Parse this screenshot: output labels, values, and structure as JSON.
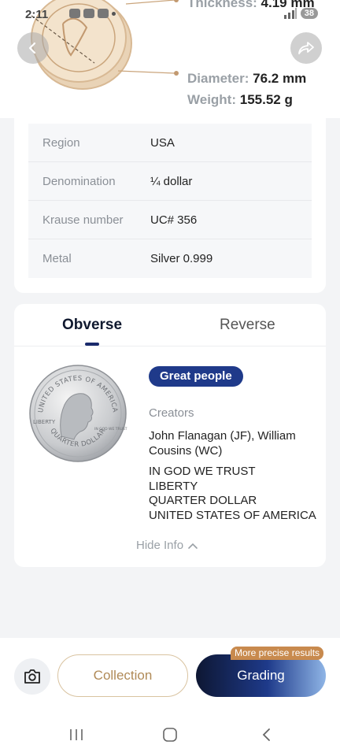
{
  "status_bar": {
    "time": "2:11",
    "battery": "38"
  },
  "specs_top": {
    "thickness_label": "Thickness:",
    "thickness_value": "4.19 mm",
    "diameter_label": "Diameter:",
    "diameter_value": "76.2 mm",
    "weight_label": "Weight:",
    "weight_value": "155.52 g"
  },
  "details": [
    {
      "label": "Region",
      "value": "USA"
    },
    {
      "label": "Denomination",
      "value": "¼ dollar"
    },
    {
      "label": "Krause number",
      "value": "UC# 356"
    },
    {
      "label": "Metal",
      "value": "Silver 0.999"
    }
  ],
  "tabs": {
    "obverse": "Obverse",
    "reverse": "Reverse",
    "active": "obverse"
  },
  "obverse": {
    "tag": "Great people",
    "creators_label": "Creators",
    "creators_value": "John Flanagan (JF), William Cousins (WC)",
    "inscription": [
      "IN GOD WE TRUST",
      "LIBERTY",
      "QUARTER DOLLAR",
      "UNITED STATES OF AMERICA"
    ],
    "coin_legend_top": "UNITED STATES OF AMERICA",
    "coin_legend_bottom": "QUARTER DOLLAR",
    "coin_liberty": "LIBERTY",
    "coin_motto": "IN GOD WE TRUST"
  },
  "hide_info": "Hide Info",
  "actions": {
    "collection": "Collection",
    "grading": "Grading",
    "precise_badge": "More precise results"
  },
  "colors": {
    "accent_navy": "#1f3a8a",
    "gold": "#b08a57",
    "badge": "#c88a4e"
  },
  "icons": [
    "back-icon",
    "share-icon",
    "camera-icon",
    "chevron-up-icon",
    "recent-apps-icon",
    "home-icon",
    "system-back-icon"
  ]
}
